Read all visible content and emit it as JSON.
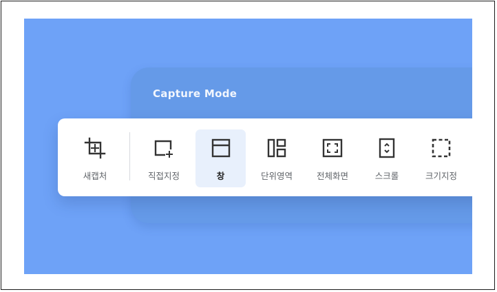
{
  "panel": {
    "title": "Capture Mode"
  },
  "toolbar": {
    "tools": [
      {
        "label": "새캡처",
        "icon": "new-capture-icon",
        "selected": false
      },
      {
        "label": "직접지정",
        "icon": "custom-region-icon",
        "selected": false
      },
      {
        "label": "창",
        "icon": "window-icon",
        "selected": true
      },
      {
        "label": "단위영역",
        "icon": "unit-area-icon",
        "selected": false
      },
      {
        "label": "전체화면",
        "icon": "fullscreen-icon",
        "selected": false
      },
      {
        "label": "스크롤",
        "icon": "scroll-icon",
        "selected": false
      },
      {
        "label": "크기지정",
        "icon": "fixed-size-icon",
        "selected": false
      }
    ]
  },
  "colors": {
    "background": "#6ea2f7",
    "panel": "#659ae8",
    "selected_bg": "#e8f0fc",
    "icon": "#333333"
  }
}
